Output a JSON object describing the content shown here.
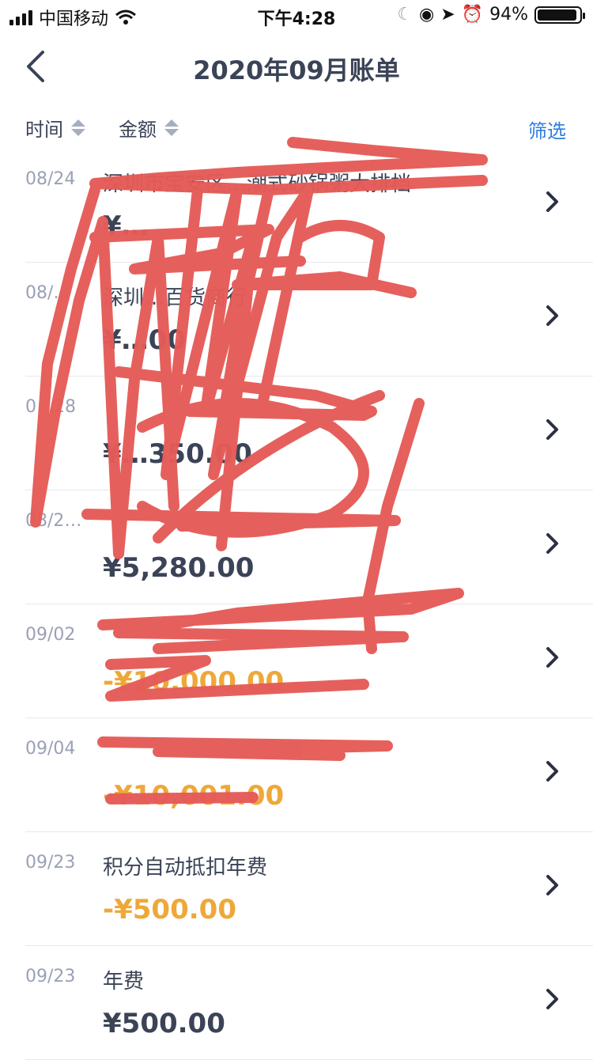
{
  "status_bar": {
    "carrier": "中国移动",
    "time": "下午4:28",
    "battery_text": "94%",
    "battery_level": 0.94
  },
  "nav": {
    "title": "2020年09月账单"
  },
  "sort_bar": {
    "time_label": "时间",
    "amount_label": "金额",
    "filter_label": "筛选"
  },
  "transactions": [
    {
      "date": "08/24",
      "desc": "深圳市宝安区…潮式砂锅粥大排档",
      "amount": "¥…",
      "negative": false
    },
    {
      "date": "08/…",
      "desc": "深圳…百货商行",
      "amount": "¥…00",
      "negative": false
    },
    {
      "date": "0…28",
      "desc": "",
      "amount": "¥…350.00",
      "negative": false
    },
    {
      "date": "08/2…",
      "desc": "",
      "amount": "¥5,280.00",
      "negative": false
    },
    {
      "date": "09/02",
      "desc": "",
      "amount": "-¥10,000.00",
      "negative": true
    },
    {
      "date": "09/04",
      "desc": "",
      "amount": "-¥10,001.00",
      "negative": true
    },
    {
      "date": "09/23",
      "desc": "积分自动抵扣年费",
      "amount": "-¥500.00",
      "negative": true
    },
    {
      "date": "09/23",
      "desc": "年费",
      "amount": "¥500.00",
      "negative": false
    }
  ],
  "colors": {
    "primary_text": "#3b4357",
    "secondary_text": "#9aa1b5",
    "negative_amount": "#eea839",
    "link": "#2f7de1",
    "scribble": "#e55b57"
  }
}
